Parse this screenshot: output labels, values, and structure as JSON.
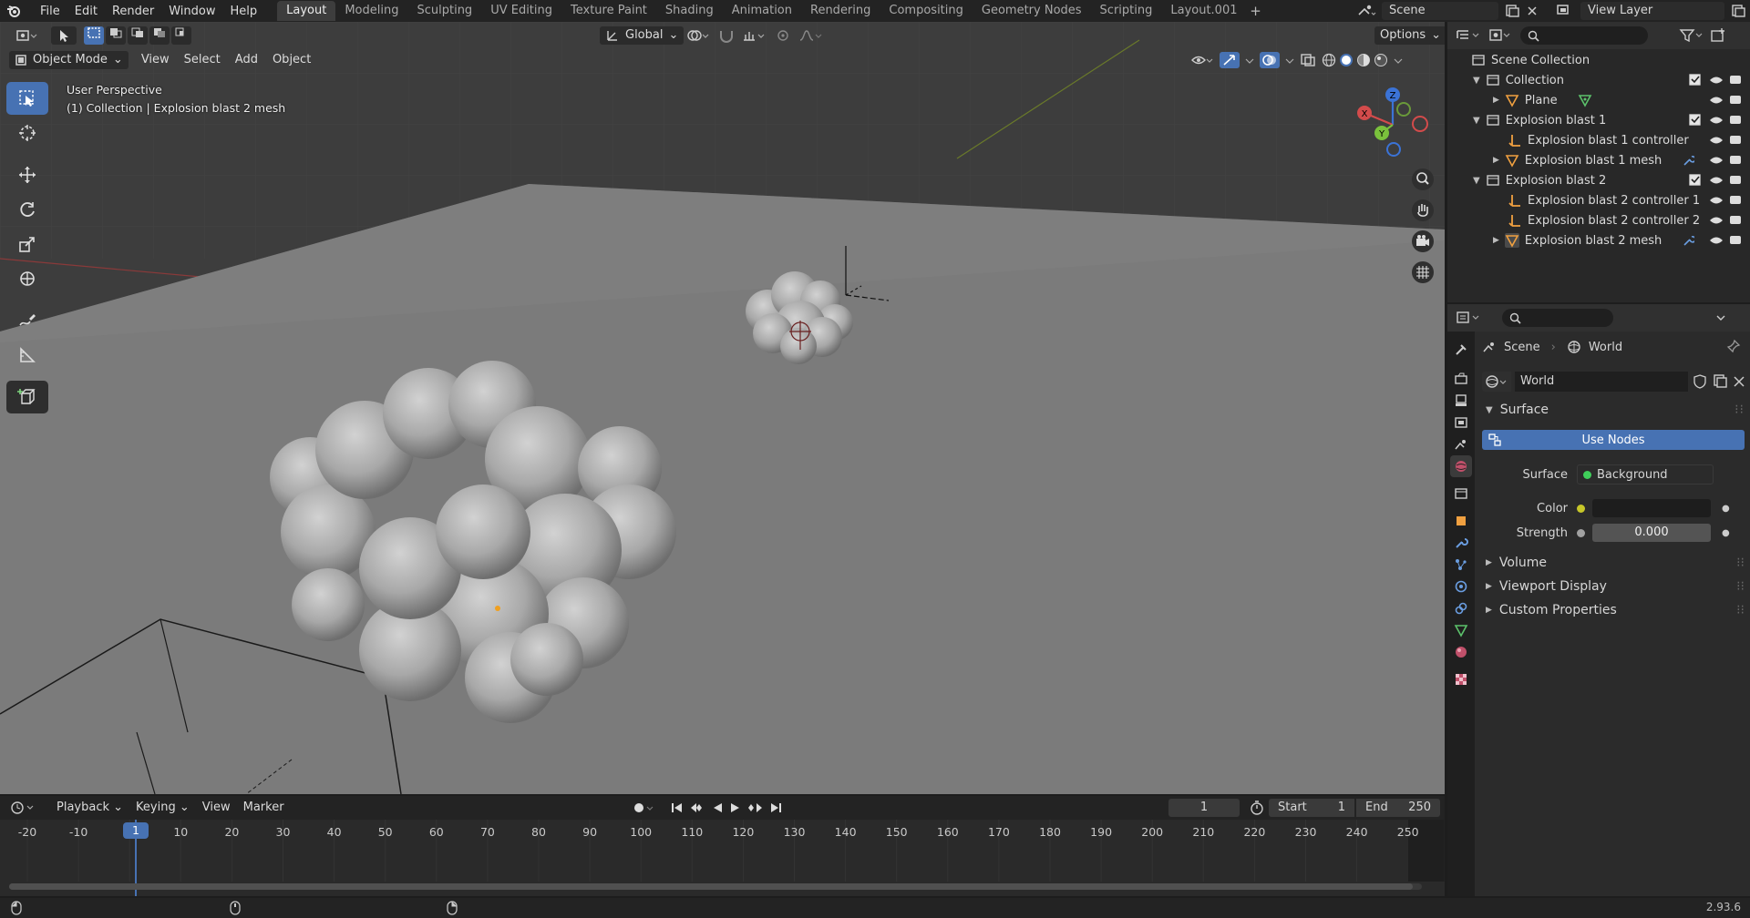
{
  "topbar": {
    "menus": [
      "File",
      "Edit",
      "Render",
      "Window",
      "Help"
    ],
    "workspaces": [
      "Layout",
      "Modeling",
      "Sculpting",
      "UV Editing",
      "Texture Paint",
      "Shading",
      "Animation",
      "Rendering",
      "Compositing",
      "Geometry Nodes",
      "Scripting",
      "Layout.001"
    ],
    "active_workspace": "Layout",
    "scene_name": "Scene",
    "view_layer": "View Layer"
  },
  "viewport": {
    "mode": "Object Mode",
    "menus": [
      "View",
      "Select",
      "Add",
      "Object"
    ],
    "transform_orientation": "Global",
    "options_label": "Options",
    "perspective_label": "User Perspective",
    "context_label": "(1) Collection | Explosion blast 2 mesh",
    "gizmo_axes": {
      "x": "X",
      "y": "Y",
      "z": "Z"
    }
  },
  "outliner": {
    "root": "Scene Collection",
    "rows": [
      {
        "label": "Collection"
      },
      {
        "label": "Plane"
      },
      {
        "label": "Explosion blast 1"
      },
      {
        "label": "Explosion blast 1 controller"
      },
      {
        "label": "Explosion blast 1 mesh"
      },
      {
        "label": "Explosion blast 2"
      },
      {
        "label": "Explosion blast 2 controller 1"
      },
      {
        "label": "Explosion blast 2 controller 2"
      },
      {
        "label": "Explosion blast 2 mesh"
      }
    ]
  },
  "properties": {
    "breadcrumb": {
      "scene": "Scene",
      "world": "World"
    },
    "world_name": "World",
    "surface_panel": "Surface",
    "use_nodes_label": "Use Nodes",
    "surface_label": "Surface",
    "surface_value": "Background",
    "color_label": "Color",
    "strength_label": "Strength",
    "strength_value": "0.000",
    "collapsed_panels": [
      "Volume",
      "Viewport Display",
      "Custom Properties"
    ],
    "colors": {
      "use_nodes": "#4772b3",
      "socket_shader": "#3fcf5a",
      "socket_color": "#c7c729",
      "socket_value": "#a1a1a1"
    }
  },
  "timeline": {
    "menus": [
      "Playback",
      "Keying",
      "View",
      "Marker"
    ],
    "current_frame": "1",
    "start_label": "Start",
    "start_value": "1",
    "end_label": "End",
    "end_value": "250",
    "ticks": [
      "-20",
      "-10",
      "1",
      "10",
      "20",
      "30",
      "40",
      "50",
      "60",
      "70",
      "80",
      "90",
      "100",
      "110",
      "120",
      "130",
      "140",
      "150",
      "160",
      "170",
      "180",
      "190",
      "200",
      "210",
      "220",
      "230",
      "240",
      "250"
    ],
    "playhead_label": "1"
  },
  "statusbar": {
    "version": "2.93.6"
  }
}
